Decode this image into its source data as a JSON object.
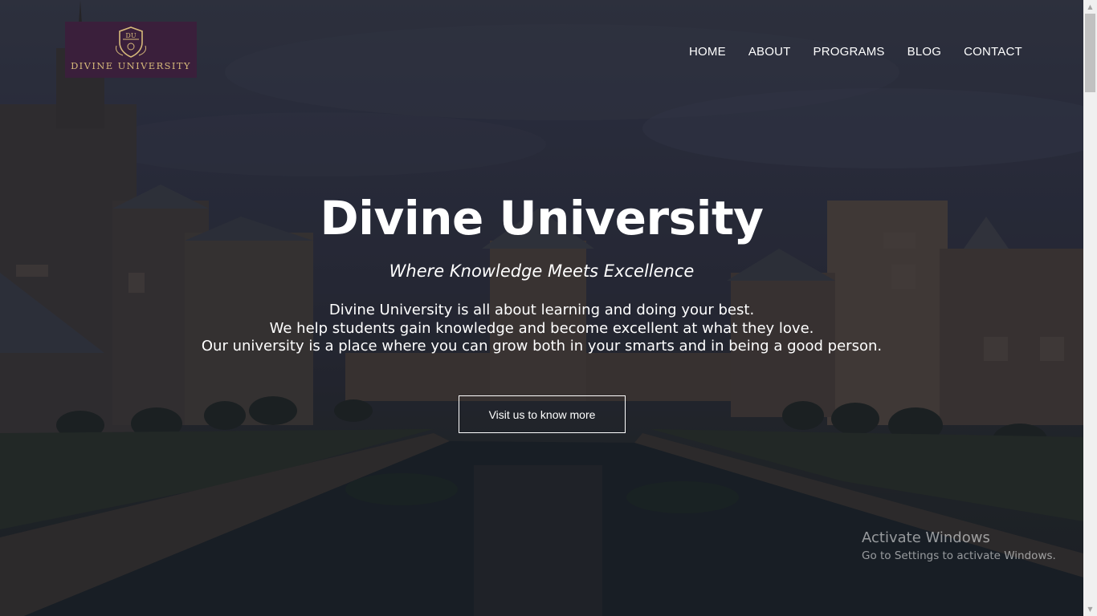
{
  "brand": {
    "name": "DIVINE UNIVERSITY",
    "crest_initials": "DU",
    "logo_bg": "#3a1f3b",
    "logo_gold": "#d6b97a"
  },
  "nav": {
    "items": [
      "HOME",
      "ABOUT",
      "PROGRAMS",
      "BLOG",
      "CONTACT"
    ]
  },
  "hero": {
    "title": "Divine University",
    "tagline": "Where Knowledge Meets Excellence",
    "description_lines": [
      "Divine University is all about learning and doing your best.",
      "We help students gain knowledge and become excellent at what they love.",
      "Our university is a place where you can grow both in your smarts and in being a good person."
    ],
    "cta_label": "Visit us to know more"
  },
  "watermark": {
    "line1": "Activate Windows",
    "line2": "Go to Settings to activate Windows."
  },
  "icons": {
    "scroll_up": "scroll-up-arrow-icon",
    "scroll_down": "scroll-down-arrow-icon",
    "crest": "university-crest-icon"
  }
}
